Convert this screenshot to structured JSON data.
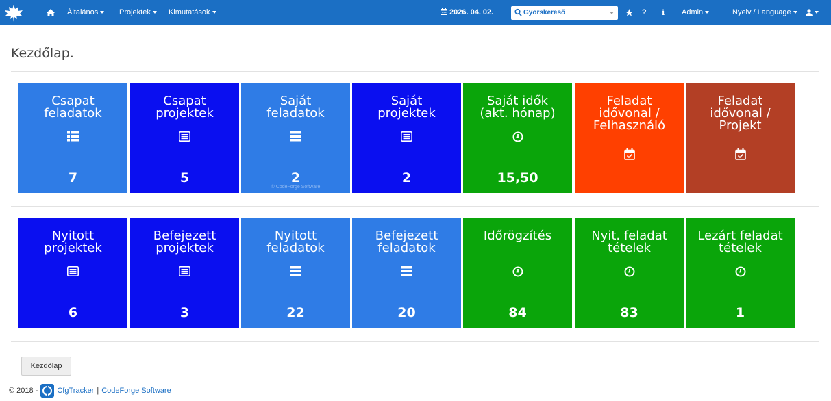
{
  "navbar": {
    "menus": [
      {
        "label": "Általános"
      },
      {
        "label": "Projektek"
      },
      {
        "label": "Kimutatások"
      }
    ],
    "date": "2026. 04. 02.",
    "search_placeholder": "Gyorskereső",
    "admin_label": "Admin",
    "language_label": "Nyelv / Language",
    "help_label": "?",
    "info_label": "i",
    "icons": [
      "maple-leaf-logo",
      "home-icon",
      "calendar-icon",
      "search-icon",
      "star-icon",
      "user-icon"
    ]
  },
  "page": {
    "title": "Kezdőlap."
  },
  "row1": [
    {
      "line1": "Csapat",
      "line2": "feladatok",
      "line3": "",
      "icon": "list-icon",
      "value": "7",
      "color": "#2f7ce6"
    },
    {
      "line1": "Csapat",
      "line2": "projektek",
      "line3": "",
      "icon": "list-alt-icon",
      "value": "5",
      "color": "#0a0ff0"
    },
    {
      "line1": "Saját",
      "line2": "feladatok",
      "line3": "",
      "icon": "list-icon",
      "value": "2",
      "color": "#2f7ce6",
      "watermark": "© CodeForge Software"
    },
    {
      "line1": "Saját",
      "line2": "projektek",
      "line3": "",
      "icon": "list-alt-icon",
      "value": "2",
      "color": "#0a0ff0"
    },
    {
      "line1": "Saját idők",
      "line2": "(akt. hónap)",
      "line3": "",
      "icon": "clock-icon",
      "value": "15,50",
      "color": "#0aa50a"
    },
    {
      "line1": "Feladat",
      "line2": "idővonal /",
      "line3": "Felhasználó",
      "icon": "calendar-check-icon",
      "value": "",
      "color": "#ff4000"
    },
    {
      "line1": "Feladat",
      "line2": "idővonal /",
      "line3": "Projekt",
      "icon": "calendar-check-icon",
      "value": "",
      "color": "#b33f25"
    }
  ],
  "row2": [
    {
      "line1": "Nyitott",
      "line2": "projektek",
      "icon": "list-alt-icon",
      "value": "6",
      "color": "#0a0ff0"
    },
    {
      "line1": "Befejezett",
      "line2": "projektek",
      "icon": "list-alt-icon",
      "value": "3",
      "color": "#0a0ff0"
    },
    {
      "line1": "Nyitott",
      "line2": "feladatok",
      "icon": "list-icon",
      "value": "22",
      "color": "#2f7ce6"
    },
    {
      "line1": "Befejezett",
      "line2": "feladatok",
      "icon": "list-icon",
      "value": "20",
      "color": "#2f7ce6"
    },
    {
      "line1": "Időrögzítés",
      "line2": "",
      "icon": "clock-icon",
      "value": "84",
      "color": "#0aa50a"
    },
    {
      "line1": "Nyit. feladat",
      "line2": "tételek",
      "icon": "clock-icon",
      "value": "83",
      "color": "#0aa50a"
    },
    {
      "line1": "Lezárt feladat",
      "line2": "tételek",
      "icon": "clock-icon",
      "value": "1",
      "color": "#0aa50a"
    }
  ],
  "footer": {
    "home_button": "Kezdőlap",
    "copyright": "© 2018 -",
    "app_link": "CfgTracker",
    "separator": "|",
    "company_link": "CodeForge Software"
  }
}
